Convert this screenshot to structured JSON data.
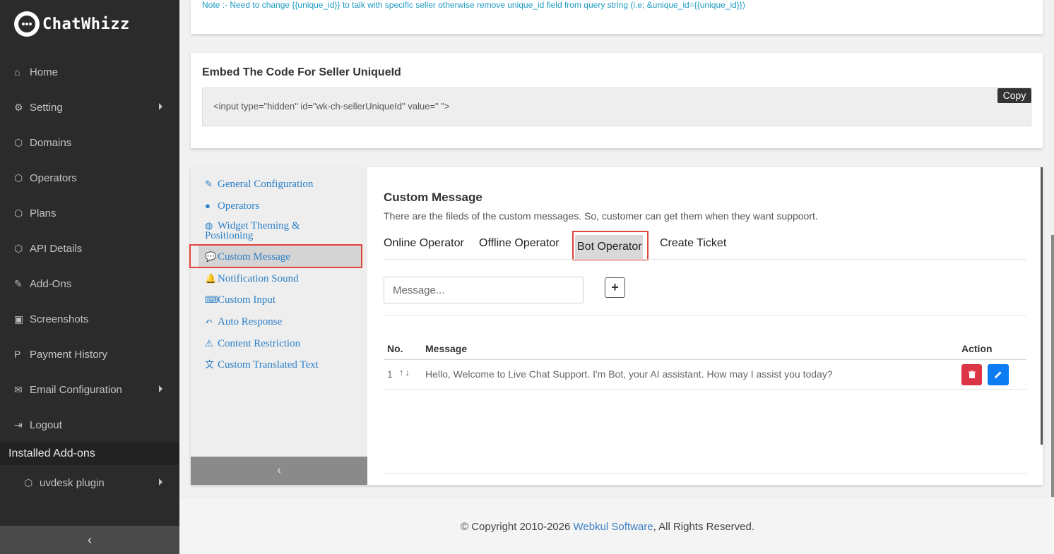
{
  "app": {
    "name": "ChatWhizz"
  },
  "sidebar": {
    "items": [
      {
        "label": "Home",
        "icon": "home-icon"
      },
      {
        "label": "Setting",
        "icon": "gears-icon",
        "has_submenu": true
      },
      {
        "label": "Domains",
        "icon": "cube-icon"
      },
      {
        "label": "Operators",
        "icon": "cube-icon"
      },
      {
        "label": "Plans",
        "icon": "cube-icon"
      },
      {
        "label": "API Details",
        "icon": "cube-icon"
      },
      {
        "label": "Add-Ons",
        "icon": "plug-icon"
      },
      {
        "label": "Screenshots",
        "icon": "camera-icon"
      },
      {
        "label": "Payment History",
        "icon": "paypal-icon"
      },
      {
        "label": "Email Configuration",
        "icon": "envelope-icon",
        "has_submenu": true
      },
      {
        "label": "Logout",
        "icon": "sign-out-icon"
      }
    ],
    "installed_label": "Installed Add-ons",
    "addon_item": {
      "label": "uvdesk plugin",
      "icon": "cube-icon"
    },
    "collapse_glyph": "‹"
  },
  "top_note": "Note :- Need to change {{unique_id}} to talk with specific seller otherwise remove unique_id field from query string (i.e; &unique_id={{unique_id}})",
  "embed": {
    "title": "Embed The Code For Seller UniqueId",
    "code": "<input type=\"hidden\" id=\"wk-ch-sellerUniqueId\" value=\" \">",
    "copy_label": "Copy"
  },
  "config_menu": {
    "items": [
      {
        "label": "General Configuration",
        "icon": "wrench-icon"
      },
      {
        "label": "Operators",
        "icon": "user-icon"
      },
      {
        "label": "Widget Theming &",
        "label2": "Positioning",
        "icon": "globe-icon"
      },
      {
        "label": "Custom Message",
        "icon": "comment-icon",
        "active": true
      },
      {
        "label": "Notification Sound",
        "icon": "bell-icon"
      },
      {
        "label": "Custom Input",
        "icon": "keyboard-icon"
      },
      {
        "label": "Auto Response",
        "icon": "reply-icon"
      },
      {
        "label": "Content Restriction",
        "icon": "warning-icon"
      },
      {
        "label": "Custom Translated Text",
        "icon": "language-icon"
      }
    ],
    "collapse_glyph": "‹"
  },
  "custom_message": {
    "title": "Custom Message",
    "subtitle": "There are the fileds of the custom messages. So, customer can get them when they want suppoort.",
    "tabs": [
      {
        "label": "Online Operator"
      },
      {
        "label": "Offline Operator"
      },
      {
        "label": "Bot Operator",
        "active": true
      },
      {
        "label": "Create Ticket"
      }
    ],
    "input_placeholder": "Message...",
    "add_glyph": "+",
    "table": {
      "headers": {
        "no": "No.",
        "message": "Message",
        "action": "Action"
      },
      "rows": [
        {
          "no": "1",
          "arrows": "↑↓",
          "message": "Hello, Welcome to Live Chat Support. I'm Bot, your AI assistant. How may I assist you today?"
        }
      ]
    }
  },
  "footer": {
    "prefix": "© Copyright 2010-2026 ",
    "link": "Webkul Software",
    "suffix": ", All Rights Reserved."
  },
  "colors": {
    "sidebar_bg": "#2b2b2b",
    "link_blue": "#2a7fc6",
    "highlight_red": "#e0453c",
    "delete_red": "#dc3545",
    "edit_blue": "#0d7cf2"
  }
}
